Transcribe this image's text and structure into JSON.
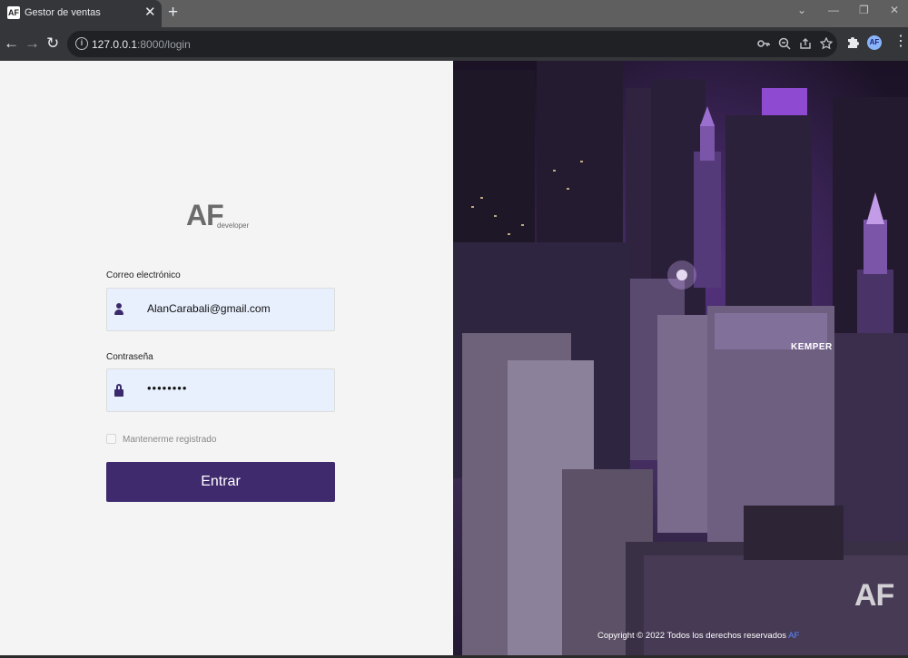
{
  "browser": {
    "tab": {
      "favicon": "AF",
      "title": "Gestor de ventas",
      "close": "✕"
    },
    "new_tab": "+",
    "window_controls": {
      "chevron": "⌄",
      "minimize": "—",
      "restore": "❐",
      "close": "✕"
    },
    "nav": {
      "back": "←",
      "forward": "→",
      "reload": "↻"
    },
    "url": {
      "host": "127.0.0.1",
      "rest": ":8000/login"
    },
    "profile_initials": "AF"
  },
  "login": {
    "logo": {
      "main": "AF",
      "sub": "developer"
    },
    "email": {
      "label": "Correo electrónico",
      "value": "AlanCarabali@gmail.com"
    },
    "password": {
      "label": "Contraseña",
      "value": "••••••••"
    },
    "remember_label": "Mantenerme registrado",
    "submit_label": "Entrar"
  },
  "hero": {
    "building_sign": "KEMPER",
    "watermark": "AF",
    "copyright": "Copyright © 2022 Todos los derechos reservados",
    "copyright_brand": "AF"
  },
  "colors": {
    "accent": "#3f2a6e",
    "input_bg": "#e8f0fe",
    "panel_bg": "#f4f4f4",
    "hero_purple": "#7b3fbf"
  }
}
